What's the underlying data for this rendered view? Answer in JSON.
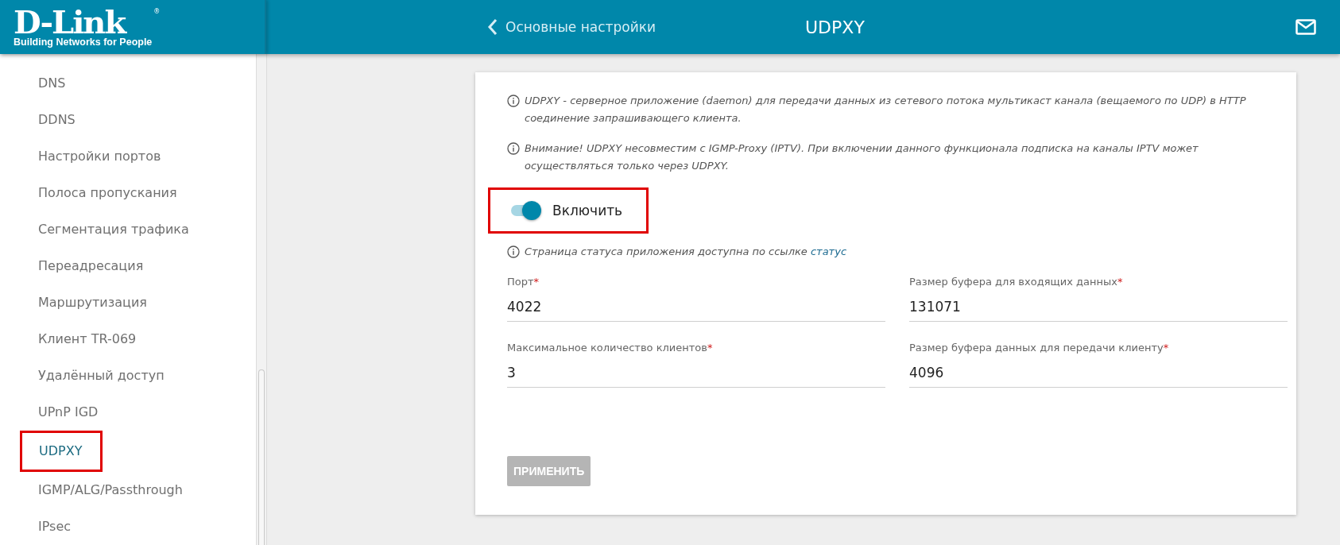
{
  "header": {
    "logo": {
      "name": "D-Link",
      "tagline": "Building Networks for People",
      "mark": "®"
    },
    "back_link": "Основные настройки",
    "title": "UDPXY"
  },
  "sidebar": {
    "items": [
      {
        "label": "DNS",
        "selected": false,
        "highlighted": false
      },
      {
        "label": "DDNS",
        "selected": false,
        "highlighted": false
      },
      {
        "label": "Настройки портов",
        "selected": false,
        "highlighted": false
      },
      {
        "label": "Полоса пропускания",
        "selected": false,
        "highlighted": false
      },
      {
        "label": "Сегментация трафика",
        "selected": false,
        "highlighted": false
      },
      {
        "label": "Переадресация",
        "selected": false,
        "highlighted": false
      },
      {
        "label": "Маршрутизация",
        "selected": false,
        "highlighted": false
      },
      {
        "label": "Клиент TR-069",
        "selected": false,
        "highlighted": false
      },
      {
        "label": "Удалённый доступ",
        "selected": false,
        "highlighted": false
      },
      {
        "label": "UPnP IGD",
        "selected": false,
        "highlighted": false
      },
      {
        "label": "UDPXY",
        "selected": true,
        "highlighted": true
      },
      {
        "label": "IGMP/ALG/Passthrough",
        "selected": false,
        "highlighted": false
      },
      {
        "label": "IPsec",
        "selected": false,
        "highlighted": false
      }
    ]
  },
  "card": {
    "notes": [
      {
        "text": "UDPXY - серверное приложение (daemon) для передачи данных из сетевого потока мультикаст канала (вещаемого по UDP) в HTTP соединение запрашивающего клиента."
      },
      {
        "text": "Внимание! UDPXY несовместим с IGMP-Proxy (IPTV). При включении данного функционала подписка на каналы IPTV может осуществляться только через UDPXY."
      }
    ],
    "toggle": {
      "label": "Включить",
      "on": true,
      "highlighted": true
    },
    "status_note": {
      "text": "Страница статуса приложения доступна по ссылке",
      "link": "статус"
    },
    "fields": [
      {
        "label": "Порт",
        "required_mark": "*",
        "value": "4022"
      },
      {
        "label": "Размер буфера для входящих данных",
        "required_mark": "*",
        "value": "131071"
      },
      {
        "label": "Максимальное количество клиентов",
        "required_mark": "*",
        "value": "3"
      },
      {
        "label": "Размер буфера данных для передачи клиенту",
        "required_mark": "*",
        "value": "4096"
      }
    ],
    "apply_button": {
      "label": "ПРИМЕНИТЬ",
      "disabled": true
    }
  }
}
